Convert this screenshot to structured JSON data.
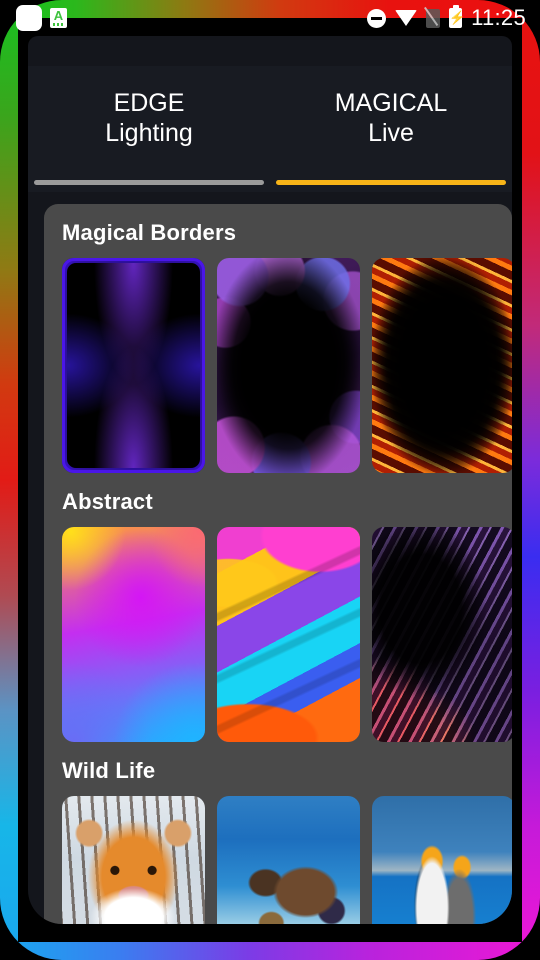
{
  "status_bar": {
    "clock": "11:25",
    "left_icons": [
      {
        "name": "notification-blank-icon",
        "glyph": "blank-badge"
      },
      {
        "name": "app-a-notification-icon",
        "glyph": "A"
      }
    ],
    "right_icons": [
      {
        "name": "do-not-disturb-icon"
      },
      {
        "name": "wifi-icon"
      },
      {
        "name": "sim-off-icon"
      },
      {
        "name": "battery-charging-icon"
      }
    ]
  },
  "tabs": [
    {
      "line1": "EDGE",
      "line2": "Lighting",
      "active": false,
      "underline_color": "#9b9b9b"
    },
    {
      "line1": "MAGICAL",
      "line2": "Live",
      "active": true,
      "underline_color": "#f7b418"
    }
  ],
  "sections": [
    {
      "title": "Magical Borders",
      "thumbs": [
        {
          "name": "thumb-neon-blue-border",
          "style": "tb-neon"
        },
        {
          "name": "thumb-purple-bokeh-border",
          "style": "tb-bokeh"
        },
        {
          "name": "thumb-fire-border",
          "style": "tb-fire"
        }
      ]
    },
    {
      "title": "Abstract",
      "thumbs": [
        {
          "name": "thumb-gradient-mesh",
          "style": "tb-mesh"
        },
        {
          "name": "thumb-color-waves",
          "style": "tb-waves"
        },
        {
          "name": "thumb-purple-marble",
          "style": "tb-marble"
        }
      ]
    },
    {
      "title": "Wild Life",
      "thumbs": [
        {
          "name": "thumb-tiger",
          "style": "tb-tiger"
        },
        {
          "name": "thumb-turtle",
          "style": "tb-turtle"
        },
        {
          "name": "thumb-penguins",
          "style": "tb-penguin"
        }
      ]
    }
  ],
  "theme": {
    "screen_background": "#14161c",
    "tab_bar_background": "#181b22",
    "panel_background": "#4a4a4a",
    "accent": "#f7b418",
    "text_primary": "#ffffff",
    "inactive_underline": "#9b9b9b"
  },
  "edge_lighting": {
    "left_gradient": [
      "#17c321",
      "#e21b16",
      "#1aa6ef"
    ],
    "right_gradient": [
      "#e8120f",
      "#3a2df0",
      "#ef17d6"
    ],
    "top_gradient": [
      "#14c41e",
      "#ec0f10"
    ],
    "bottom_gradient": [
      "#18a9ef",
      "#ee17d4"
    ]
  }
}
